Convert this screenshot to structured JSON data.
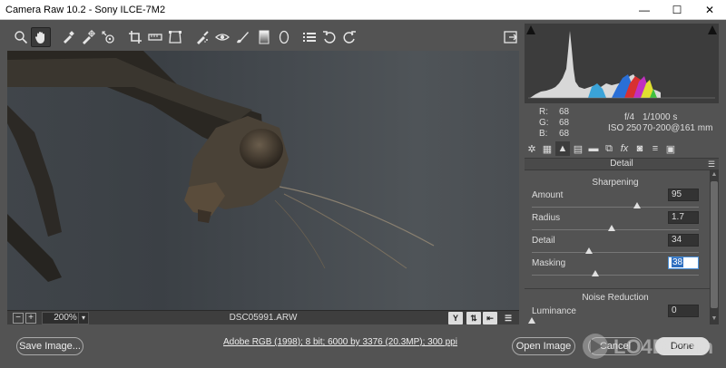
{
  "window": {
    "title": "Camera Raw 10.2  -  Sony ILCE-7M2",
    "minimize": "—",
    "maximize": "☐",
    "close": "✕"
  },
  "toolbar": {
    "tools": [
      "zoom-icon",
      "hand-icon",
      "white-balance-icon",
      "color-sampler-icon",
      "targeted-adjustment-icon",
      "crop-icon",
      "straighten-icon",
      "transform-icon",
      "spot-removal-icon",
      "red-eye-icon",
      "adjustment-brush-icon",
      "graduated-filter-icon",
      "radial-filter-icon",
      "preferences-icon",
      "rotate-ccw-icon",
      "rotate-cw-icon"
    ],
    "active_tool": "hand-icon"
  },
  "readout": {
    "r_label": "R:",
    "r": "68",
    "g_label": "G:",
    "g": "68",
    "b_label": "B:",
    "b": "68",
    "aperture": "f/4",
    "shutter": "1/1000 s",
    "iso": "ISO 250",
    "lens": "70-200@161 mm"
  },
  "panel": {
    "title": "Detail",
    "sharpening": {
      "title": "Sharpening",
      "sliders": [
        {
          "label": "Amount",
          "value": "95",
          "level": 0.63
        },
        {
          "label": "Radius",
          "value": "1.7",
          "level": 0.48
        },
        {
          "label": "Detail",
          "value": "34",
          "level": 0.34
        },
        {
          "label": "Masking",
          "value": "38",
          "level": 0.38
        }
      ]
    },
    "noise_reduction": {
      "title": "Noise Reduction",
      "sliders": [
        {
          "label": "Luminance",
          "value": "0",
          "level": 0.0
        }
      ]
    }
  },
  "status": {
    "zoom": "200%",
    "filename": "DSC05991.ARW",
    "zoom_out": "−",
    "zoom_in": "+",
    "y_button": "Y"
  },
  "bottom": {
    "save_label": "Save Image...",
    "workflow": "Adobe RGB (1998); 8 bit; 6000 by 3376 (20.3MP); 300 ppi",
    "open_label": "Open Image",
    "cancel_label": "Cancel",
    "done_label": "Done"
  },
  "colors": {
    "app_bg": "#535353",
    "highlight": "#2f6fc0"
  }
}
